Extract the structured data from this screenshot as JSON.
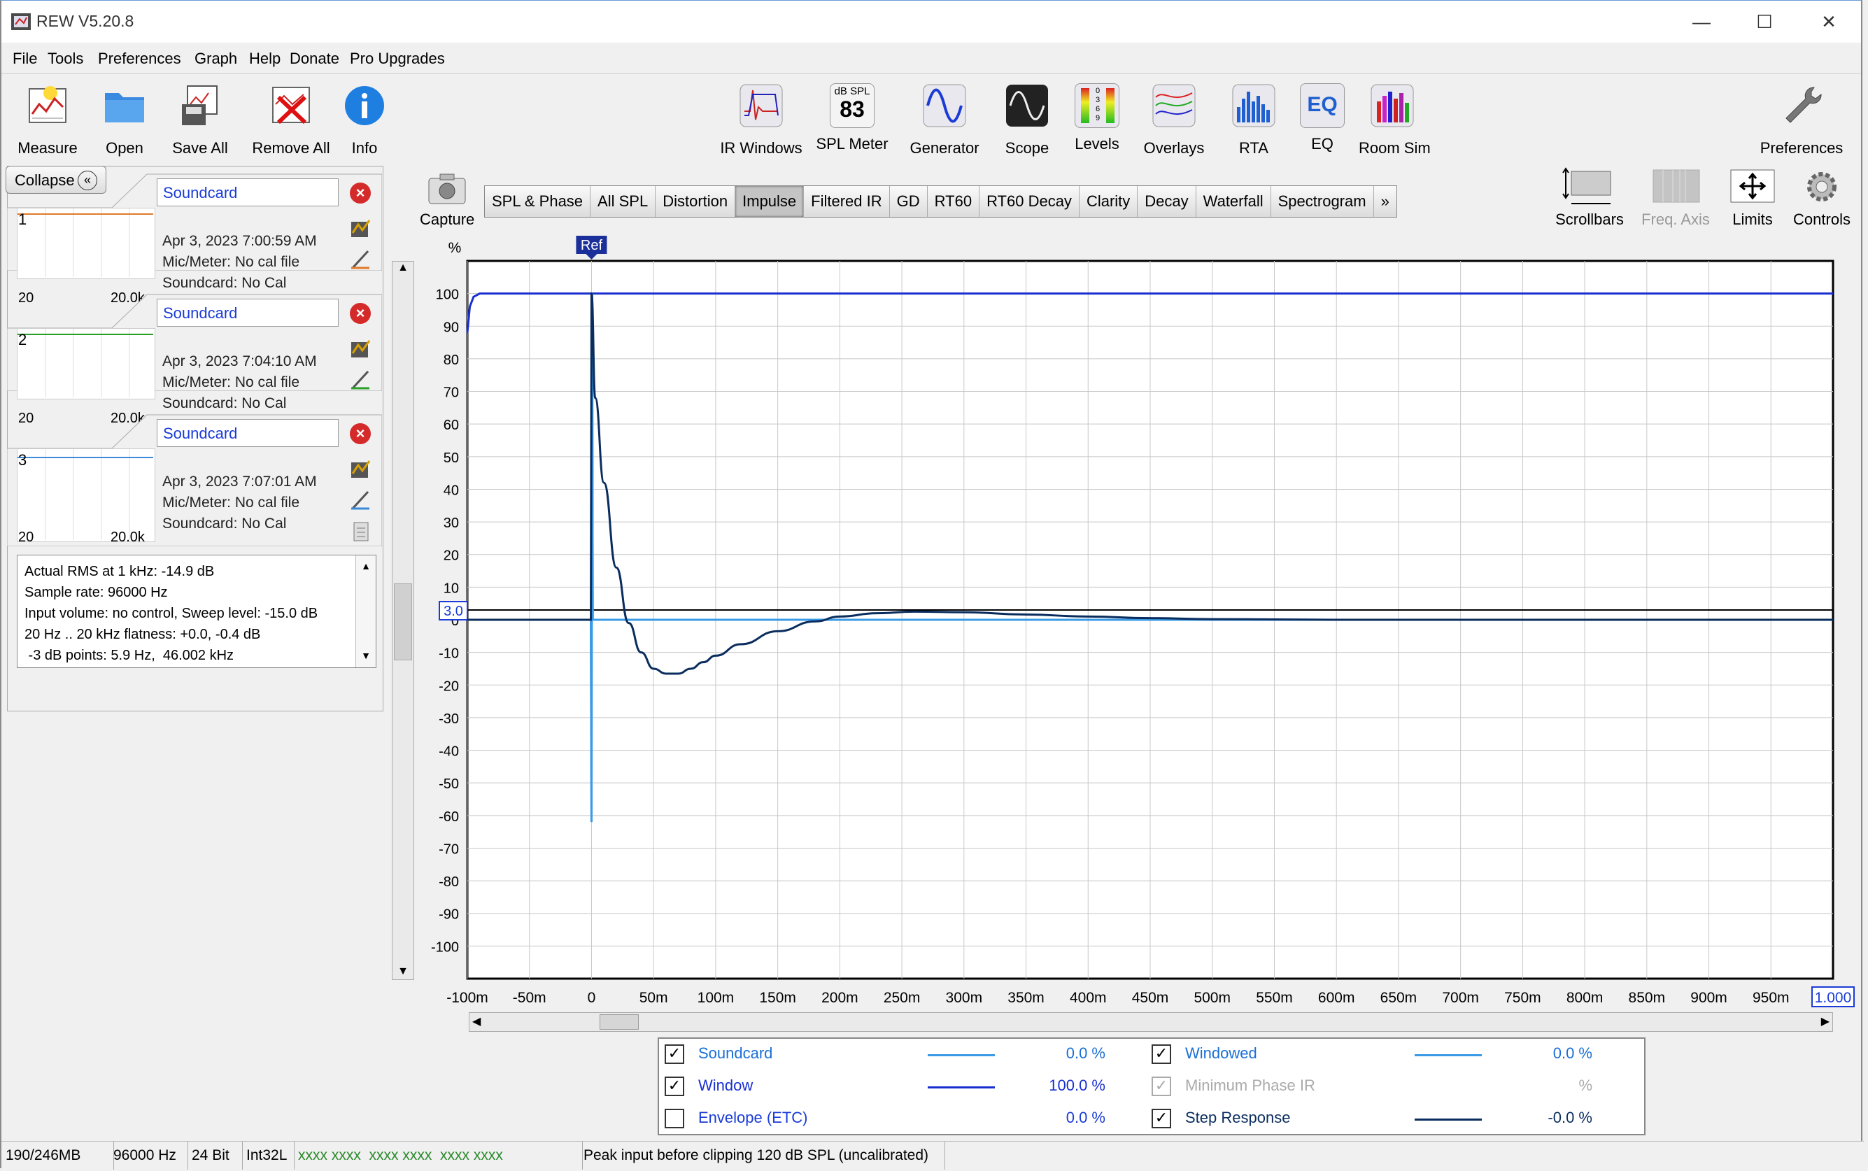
{
  "window": {
    "title": "REW V5.20.8",
    "minimize": "—",
    "maximize": "☐",
    "close": "✕"
  },
  "menu": [
    "File",
    "Tools",
    "Preferences",
    "Graph",
    "Help",
    "Donate",
    "Pro Upgrades"
  ],
  "toolbar_left": [
    "Measure",
    "Open",
    "Save All",
    "Remove All",
    "Info"
  ],
  "toolbar_center": [
    "IR Windows",
    "SPL Meter",
    "Generator",
    "Scope",
    "Levels",
    "Overlays",
    "RTA",
    "EQ",
    "Room Sim"
  ],
  "toolbar_right": {
    "preferences": "Preferences"
  },
  "spl_meter_icon": {
    "unit": "dB SPL",
    "value": "83"
  },
  "eq_icon_text": "EQ",
  "levels_icon_digits": [
    "0",
    "3",
    "6",
    "9"
  ],
  "collapse_label": "Collapse",
  "measurements": [
    {
      "num": "1",
      "name": "Soundcard",
      "date": "Apr 3, 2023 7:00:59 AM",
      "mic": "Mic/Meter: No cal file",
      "card": "Soundcard: No Cal",
      "range_lo": "20",
      "range_hi": "20.0k",
      "trace_color": "#e07a2a",
      "pencil_color": "#e07a2a"
    },
    {
      "num": "2",
      "name": "Soundcard",
      "date": "Apr 3, 2023 7:04:10 AM",
      "mic": "Mic/Meter: No cal file",
      "card": "Soundcard: No Cal",
      "range_lo": "20",
      "range_hi": "20.0k",
      "trace_color": "#2aa02a",
      "pencil_color": "#2aa02a"
    },
    {
      "num": "3",
      "name": "Soundcard",
      "date": "Apr 3, 2023 7:07:01 AM",
      "mic": "Mic/Meter: No cal file",
      "card": "Soundcard: No Cal",
      "range_lo": "20",
      "range_hi": "20.0k",
      "trace_color": "#3a8ad8",
      "pencil_color": "#3a8ad8"
    }
  ],
  "peek_text": "Actual RMS",
  "info_lines": [
    "Actual RMS at 1 kHz: -14.9 dB",
    "Sample rate: 96000 Hz",
    "Input volume: no control, Sweep level: -15.0 dB",
    "20 Hz .. 20 kHz flatness: +0.0, -0.4 dB",
    " -3 dB points: 5.9 Hz,  46.002 kHz"
  ],
  "capture_label": "Capture",
  "graph_tabs": [
    "SPL & Phase",
    "All SPL",
    "Distortion",
    "Impulse",
    "Filtered IR",
    "GD",
    "RT60",
    "RT60 Decay",
    "Clarity",
    "Decay",
    "Waterfall",
    "Spectrogram",
    "»"
  ],
  "active_tab": "Impulse",
  "right_tools": [
    "Scrollbars",
    "Freq. Axis",
    "Limits",
    "Controls"
  ],
  "chart_data": {
    "type": "line",
    "ylabel": "%",
    "ylim": [
      -110,
      110
    ],
    "xlim": [
      -100,
      1000
    ],
    "y_ticks": [
      100,
      90,
      80,
      70,
      60,
      50,
      40,
      30,
      20,
      10,
      0,
      -10,
      -20,
      -30,
      -40,
      -50,
      -60,
      -70,
      -80,
      -90,
      -100
    ],
    "y_tick_labels": [
      "100",
      "90",
      "80",
      "70",
      "60",
      "50",
      "40",
      "30",
      "20",
      "10",
      "0",
      "-10",
      "-20",
      "-30",
      "-40",
      "-50",
      "-60",
      "-70",
      "-80",
      "-90",
      "-100"
    ],
    "x_ticks": [
      -100,
      -50,
      0,
      50,
      100,
      150,
      200,
      250,
      300,
      350,
      400,
      450,
      500,
      550,
      600,
      650,
      700,
      750,
      800,
      850,
      900,
      950
    ],
    "x_tick_labels": [
      "-100m",
      "-50m",
      "0",
      "50m",
      "100m",
      "150m",
      "200m",
      "250m",
      "300m",
      "350m",
      "400m",
      "450m",
      "500m",
      "550m",
      "600m",
      "650m",
      "700m",
      "750m",
      "800m",
      "850m",
      "900m",
      "950m"
    ],
    "x_end_label": "1.000",
    "y_cursor_label": "3.0",
    "ref_marker": {
      "label": "Ref",
      "x": 0
    },
    "grid": true,
    "series": [
      {
        "name": "Window",
        "color": "#1a2fd0",
        "x": [
          -100,
          -98,
          -95,
          -90,
          -80,
          1000
        ],
        "y": [
          88,
          96,
          99,
          100,
          100,
          100
        ]
      },
      {
        "name": "Soundcard",
        "color": "#3a9ae6",
        "x": [
          -100,
          -0.5,
          0,
          0.5,
          1,
          1000
        ],
        "y": [
          0,
          0,
          -62,
          100,
          0,
          0
        ]
      },
      {
        "name": "Windowed",
        "color": "#3a9ae6",
        "x": [
          -100,
          -0.5,
          0,
          0.5,
          1,
          1000
        ],
        "y": [
          0,
          0,
          -62,
          100,
          0,
          0
        ]
      },
      {
        "name": "Step Response",
        "color": "#0a2d5e",
        "x": [
          -100,
          -0.5,
          0,
          3,
          10,
          20,
          30,
          40,
          50,
          60,
          70,
          80,
          90,
          100,
          120,
          150,
          180,
          200,
          230,
          260,
          300,
          350,
          400,
          450,
          500,
          550,
          600,
          1000
        ],
        "y": [
          0,
          0,
          100,
          68,
          42,
          16,
          -1,
          -10,
          -15,
          -16.5,
          -16.5,
          -15,
          -13,
          -11,
          -7.5,
          -3.5,
          -0.5,
          1,
          2,
          2.5,
          2.3,
          1.6,
          1,
          0.5,
          0.2,
          0.1,
          0,
          0
        ]
      }
    ]
  },
  "legend": [
    {
      "name": "Soundcard",
      "checked": true,
      "value": "0.0 %",
      "color": "#3a9ae6",
      "enabled": true
    },
    {
      "name": "Window",
      "checked": true,
      "value": "100.0 %",
      "color": "#1a2fd0",
      "enabled": true
    },
    {
      "name": "Envelope (ETC)",
      "checked": false,
      "value": "0.0 %",
      "color": "",
      "enabled": true
    },
    {
      "name": "Windowed",
      "checked": true,
      "value": "0.0 %",
      "color": "#3a9ae6",
      "enabled": true
    },
    {
      "name": "Minimum Phase IR",
      "checked": true,
      "value": "%",
      "color": "",
      "enabled": false
    },
    {
      "name": "Step Response",
      "checked": true,
      "value": "-0.0 %",
      "color": "#0a2d5e",
      "enabled": true
    }
  ],
  "status": [
    "190/246MB",
    "96000 Hz",
    "24 Bit",
    "Int32L",
    "xxxx xxxx  xxxx xxxx  xxxx xxxx",
    "Peak input before clipping 120 dB SPL (uncalibrated)"
  ]
}
